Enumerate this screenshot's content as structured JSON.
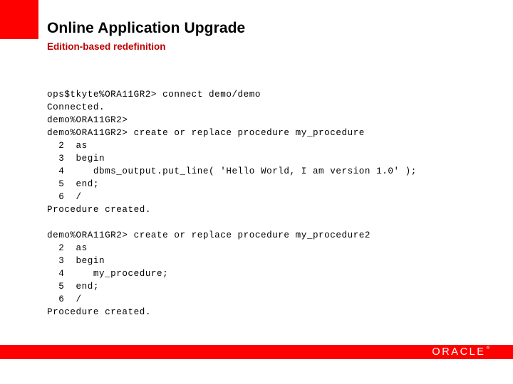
{
  "slide": {
    "title": "Online Application Upgrade",
    "subtitle": "Edition-based redefinition",
    "accent_color": "#FF0000",
    "subtitle_color": "#C00000",
    "background_color": "#FFFFFF"
  },
  "terminal": {
    "lines": [
      "ops$tkyte%ORA11GR2> connect demo/demo",
      "Connected.",
      "demo%ORA11GR2>",
      "demo%ORA11GR2> create or replace procedure my_procedure",
      "  2  as",
      "  3  begin",
      "  4     dbms_output.put_line( 'Hello World, I am version 1.0' );",
      "  5  end;",
      "  6  /",
      "Procedure created.",
      "",
      "demo%ORA11GR2> create or replace procedure my_procedure2",
      "  2  as",
      "  3  begin",
      "  4     my_procedure;",
      "  5  end;",
      "  6  /",
      "Procedure created."
    ]
  },
  "footer": {
    "bar_color": "#FF0000",
    "logo_text": "ORACLE",
    "logo_registered_mark": "®"
  }
}
